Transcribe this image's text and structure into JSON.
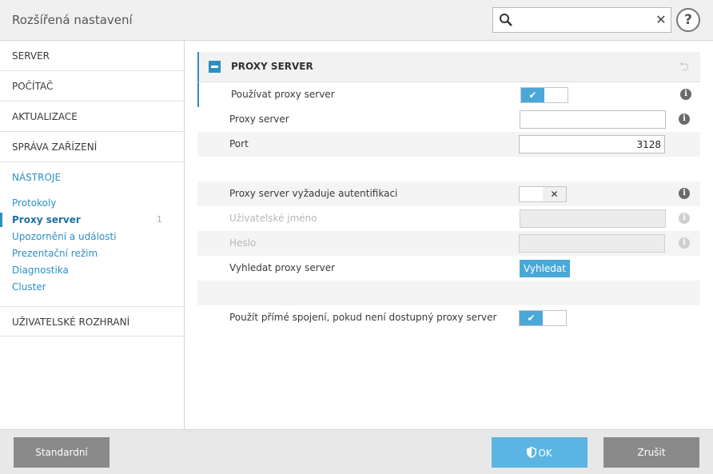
{
  "window": {
    "title": "Rozšířená nastavení"
  },
  "search": {
    "value": "",
    "placeholder": "",
    "clear_glyph": "✕"
  },
  "help": {
    "glyph": "?"
  },
  "sidebar": {
    "categories": [
      {
        "label": "SERVER"
      },
      {
        "label": "POČÍTAČ"
      },
      {
        "label": "AKTUALIZACE"
      },
      {
        "label": "SPRÁVA ZAŘÍZENÍ"
      },
      {
        "label": "NÁSTROJE"
      },
      {
        "label": "UŽIVATELSKÉ ROZHRANÍ"
      }
    ],
    "tools_items": [
      {
        "label": "Protokoly"
      },
      {
        "label": "Proxy server",
        "count": "1"
      },
      {
        "label": "Upozornění a události"
      },
      {
        "label": "Prezentační režim"
      },
      {
        "label": "Diagnostika"
      },
      {
        "label": "Cluster"
      }
    ]
  },
  "section": {
    "title": "PROXY SERVER",
    "revert_glyph": "⮌",
    "rows": [
      {
        "label": "Používat proxy server",
        "toggle_glyph": "✔"
      },
      {
        "label": "Proxy server",
        "value": ""
      },
      {
        "label": "Port",
        "value": "3128"
      },
      {
        "label": "Proxy server vyžaduje autentifikaci",
        "toggle_glyph": "✕"
      },
      {
        "label": "Uživatelské jméno",
        "value": ""
      },
      {
        "label": "Heslo",
        "value": ""
      },
      {
        "label": "Vyhledat proxy server",
        "button": "Vyhledat"
      },
      {
        "label": "Použít přímé spojení, pokud není dostupný proxy server",
        "toggle_glyph": "✔"
      }
    ],
    "info_glyph": "i"
  },
  "footer": {
    "default_label": "Standardní",
    "ok_label": "OK",
    "cancel_label": "Zrušit"
  },
  "colors": {
    "accent": "#2b8fc4",
    "toggle_on": "#4aa8d8",
    "ok_button": "#5bb5e3",
    "gray_button": "#8a8a8a"
  },
  "icons": [
    "search-icon",
    "close-icon",
    "help-icon",
    "collapse-icon",
    "revert-icon",
    "info-icon",
    "check-icon",
    "shield-icon"
  ]
}
